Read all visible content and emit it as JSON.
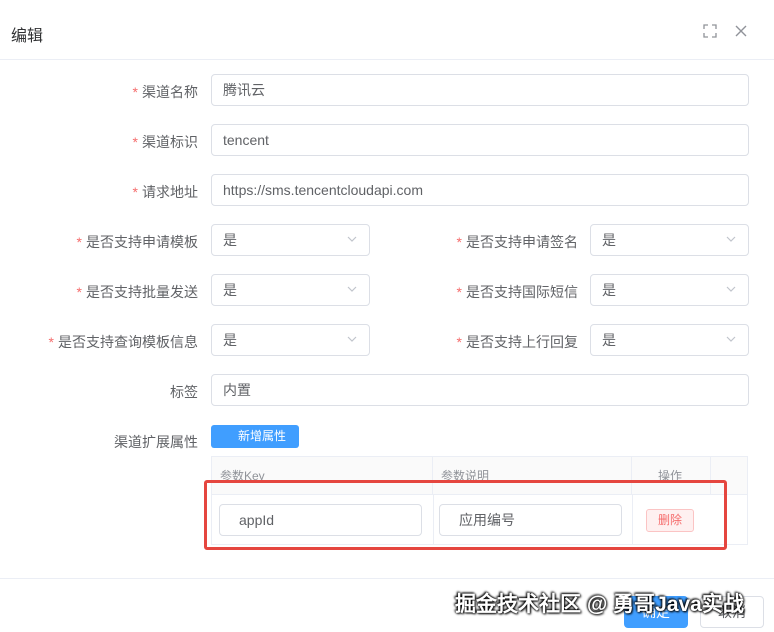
{
  "dialog": {
    "title": "编辑"
  },
  "form": {
    "channel_name": {
      "label": "渠道名称",
      "value": "腾讯云"
    },
    "channel_id": {
      "label": "渠道标识",
      "value": "tencent"
    },
    "request_url": {
      "label": "请求地址",
      "value": "https://sms.tencentcloudapi.com"
    },
    "template_apply": {
      "label": "是否支持申请模板",
      "value": "是"
    },
    "sign_apply": {
      "label": "是否支持申请签名",
      "value": "是"
    },
    "batch_send": {
      "label": "是否支持批量发送",
      "value": "是"
    },
    "intl_sms": {
      "label": "是否支持国际短信",
      "value": "是"
    },
    "template_query": {
      "label": "是否支持查询模板信息",
      "value": "是"
    },
    "uplink_reply": {
      "label": "是否支持上行回复",
      "value": "是"
    },
    "tag": {
      "label": "标签",
      "value": "内置"
    },
    "ext_attrs": {
      "label": "渠道扩展属性",
      "add_label": "新增属性"
    },
    "required_mark": "*"
  },
  "table": {
    "headers": {
      "key": "参数Key",
      "desc": "参数说明",
      "op": "操作"
    },
    "rows": [
      {
        "key": "appId",
        "desc": "应用编号",
        "op": "删除"
      }
    ]
  },
  "footer": {
    "confirm": "确定",
    "cancel": "取消"
  },
  "watermark": "掘金技术社区 @ 勇哥Java实战",
  "colors": {
    "primary": "#409eff",
    "danger": "#f56c6c",
    "highlight": "#e5463f"
  }
}
